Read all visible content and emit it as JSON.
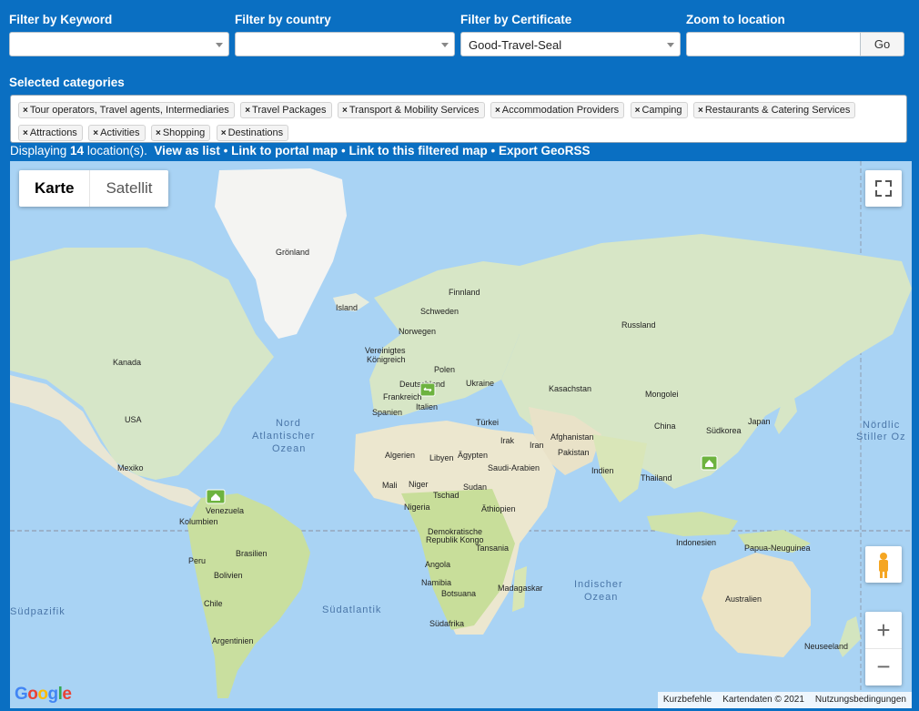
{
  "filters": {
    "keyword": {
      "label": "Filter by Keyword",
      "value": ""
    },
    "country": {
      "label": "Filter by country",
      "value": ""
    },
    "certificate": {
      "label": "Filter by Certificate",
      "value": "Good-Travel-Seal"
    },
    "zoom": {
      "label": "Zoom to location",
      "value": "",
      "button": "Go"
    }
  },
  "categories": {
    "header": "Selected categories",
    "remove_symbol": "×",
    "items": [
      "Tour operators, Travel agents, Intermediaries",
      "Travel Packages",
      "Transport & Mobility Services",
      "Accommodation Providers",
      "Camping",
      "Restaurants & Catering Services",
      "Attractions",
      "Activities",
      "Shopping",
      "Destinations"
    ]
  },
  "status": {
    "prefix": "Displaying ",
    "count": "14",
    "suffix": " location(s).",
    "links": {
      "list": "View as list",
      "portal": "Link to portal map",
      "filtered": "Link to this filtered map",
      "georss": "Export GeoRSS"
    },
    "separator": "•"
  },
  "map": {
    "type_buttons": {
      "map": "Karte",
      "satellite": "Satellit"
    },
    "fullscreen_icon": "fullscreen-icon",
    "pegman_icon": "pegman-icon",
    "zoom_in": "+",
    "zoom_out": "−",
    "google_logo": "Google",
    "attribution": {
      "shortcuts": "Kurzbefehle",
      "data": "Kartendaten © 2021",
      "terms": "Nutzungsbedingungen"
    },
    "labels": {
      "greenland": "Grönland",
      "iceland": "Island",
      "finland": "Finnland",
      "sweden": "Schweden",
      "norway": "Norwegen",
      "uk_1": "Vereinigtes",
      "uk_2": "Königreich",
      "poland": "Polen",
      "germany": "Deutschland",
      "ukraine": "Ukraine",
      "france": "Frankreich",
      "italy": "Italien",
      "spain": "Spanien",
      "russia": "Russland",
      "kazakhstan": "Kasachstan",
      "mongolia": "Mongolei",
      "china": "China",
      "skorea": "Südkorea",
      "japan": "Japan",
      "turkey": "Türkei",
      "iraq": "Irak",
      "iran": "Iran",
      "afghanistan": "Afghanistan",
      "pakistan": "Pakistan",
      "india": "Indien",
      "thailand": "Thailand",
      "saudi": "Saudi-Arabien",
      "egypt": "Ägypten",
      "libya": "Libyen",
      "algeria": "Algerien",
      "mali": "Mali",
      "niger": "Niger",
      "chad": "Tschad",
      "sudan": "Sudan",
      "nigeria": "Nigeria",
      "ethiopia": "Äthiopien",
      "drc_1": "Demokratische",
      "drc_2": "Republik Kongo",
      "tanzania": "Tansania",
      "angola": "Angola",
      "namibia": "Namibia",
      "botswana": "Botsuana",
      "madagascar": "Madagaskar",
      "southafrica": "Südafrika",
      "canada": "Kanada",
      "usa": "USA",
      "mexico": "Mexiko",
      "venezuela": "Venezuela",
      "colombia": "Kolumbien",
      "brazil": "Brasilien",
      "peru": "Peru",
      "bolivia": "Bolivien",
      "chile": "Chile",
      "argentina": "Argentinien",
      "indonesia": "Indonesien",
      "png": "Papua-Neuguinea",
      "australia": "Australien",
      "newzealand": "Neuseeland",
      "north_atlantic_1": "Nord",
      "north_atlantic_2": "Atlantischer",
      "north_atlantic_3": "Ozean",
      "south_atlantic": "Südatlantik",
      "indian_1": "Indischer",
      "indian_2": "Ozean",
      "south_pacific": "Südpazifik",
      "north_pacific_1": "Nördlic",
      "north_pacific_2": "Stiller Oz"
    },
    "markers": [
      "home-marker-icon",
      "transport-marker-icon"
    ]
  }
}
